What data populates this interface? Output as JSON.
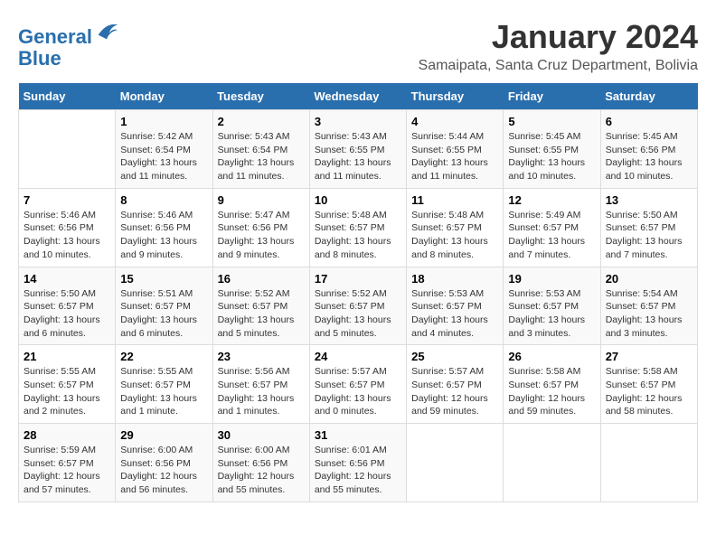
{
  "logo": {
    "line1": "General",
    "line2": "Blue"
  },
  "title": "January 2024",
  "subtitle": "Samaipata, Santa Cruz Department, Bolivia",
  "days_of_week": [
    "Sunday",
    "Monday",
    "Tuesday",
    "Wednesday",
    "Thursday",
    "Friday",
    "Saturday"
  ],
  "weeks": [
    [
      {
        "day": "",
        "sunrise": "",
        "sunset": "",
        "daylight": ""
      },
      {
        "day": "1",
        "sunrise": "Sunrise: 5:42 AM",
        "sunset": "Sunset: 6:54 PM",
        "daylight": "Daylight: 13 hours and 11 minutes."
      },
      {
        "day": "2",
        "sunrise": "Sunrise: 5:43 AM",
        "sunset": "Sunset: 6:54 PM",
        "daylight": "Daylight: 13 hours and 11 minutes."
      },
      {
        "day": "3",
        "sunrise": "Sunrise: 5:43 AM",
        "sunset": "Sunset: 6:55 PM",
        "daylight": "Daylight: 13 hours and 11 minutes."
      },
      {
        "day": "4",
        "sunrise": "Sunrise: 5:44 AM",
        "sunset": "Sunset: 6:55 PM",
        "daylight": "Daylight: 13 hours and 11 minutes."
      },
      {
        "day": "5",
        "sunrise": "Sunrise: 5:45 AM",
        "sunset": "Sunset: 6:55 PM",
        "daylight": "Daylight: 13 hours and 10 minutes."
      },
      {
        "day": "6",
        "sunrise": "Sunrise: 5:45 AM",
        "sunset": "Sunset: 6:56 PM",
        "daylight": "Daylight: 13 hours and 10 minutes."
      }
    ],
    [
      {
        "day": "7",
        "sunrise": "Sunrise: 5:46 AM",
        "sunset": "Sunset: 6:56 PM",
        "daylight": "Daylight: 13 hours and 10 minutes."
      },
      {
        "day": "8",
        "sunrise": "Sunrise: 5:46 AM",
        "sunset": "Sunset: 6:56 PM",
        "daylight": "Daylight: 13 hours and 9 minutes."
      },
      {
        "day": "9",
        "sunrise": "Sunrise: 5:47 AM",
        "sunset": "Sunset: 6:56 PM",
        "daylight": "Daylight: 13 hours and 9 minutes."
      },
      {
        "day": "10",
        "sunrise": "Sunrise: 5:48 AM",
        "sunset": "Sunset: 6:57 PM",
        "daylight": "Daylight: 13 hours and 8 minutes."
      },
      {
        "day": "11",
        "sunrise": "Sunrise: 5:48 AM",
        "sunset": "Sunset: 6:57 PM",
        "daylight": "Daylight: 13 hours and 8 minutes."
      },
      {
        "day": "12",
        "sunrise": "Sunrise: 5:49 AM",
        "sunset": "Sunset: 6:57 PM",
        "daylight": "Daylight: 13 hours and 7 minutes."
      },
      {
        "day": "13",
        "sunrise": "Sunrise: 5:50 AM",
        "sunset": "Sunset: 6:57 PM",
        "daylight": "Daylight: 13 hours and 7 minutes."
      }
    ],
    [
      {
        "day": "14",
        "sunrise": "Sunrise: 5:50 AM",
        "sunset": "Sunset: 6:57 PM",
        "daylight": "Daylight: 13 hours and 6 minutes."
      },
      {
        "day": "15",
        "sunrise": "Sunrise: 5:51 AM",
        "sunset": "Sunset: 6:57 PM",
        "daylight": "Daylight: 13 hours and 6 minutes."
      },
      {
        "day": "16",
        "sunrise": "Sunrise: 5:52 AM",
        "sunset": "Sunset: 6:57 PM",
        "daylight": "Daylight: 13 hours and 5 minutes."
      },
      {
        "day": "17",
        "sunrise": "Sunrise: 5:52 AM",
        "sunset": "Sunset: 6:57 PM",
        "daylight": "Daylight: 13 hours and 5 minutes."
      },
      {
        "day": "18",
        "sunrise": "Sunrise: 5:53 AM",
        "sunset": "Sunset: 6:57 PM",
        "daylight": "Daylight: 13 hours and 4 minutes."
      },
      {
        "day": "19",
        "sunrise": "Sunrise: 5:53 AM",
        "sunset": "Sunset: 6:57 PM",
        "daylight": "Daylight: 13 hours and 3 minutes."
      },
      {
        "day": "20",
        "sunrise": "Sunrise: 5:54 AM",
        "sunset": "Sunset: 6:57 PM",
        "daylight": "Daylight: 13 hours and 3 minutes."
      }
    ],
    [
      {
        "day": "21",
        "sunrise": "Sunrise: 5:55 AM",
        "sunset": "Sunset: 6:57 PM",
        "daylight": "Daylight: 13 hours and 2 minutes."
      },
      {
        "day": "22",
        "sunrise": "Sunrise: 5:55 AM",
        "sunset": "Sunset: 6:57 PM",
        "daylight": "Daylight: 13 hours and 1 minute."
      },
      {
        "day": "23",
        "sunrise": "Sunrise: 5:56 AM",
        "sunset": "Sunset: 6:57 PM",
        "daylight": "Daylight: 13 hours and 1 minutes."
      },
      {
        "day": "24",
        "sunrise": "Sunrise: 5:57 AM",
        "sunset": "Sunset: 6:57 PM",
        "daylight": "Daylight: 13 hours and 0 minutes."
      },
      {
        "day": "25",
        "sunrise": "Sunrise: 5:57 AM",
        "sunset": "Sunset: 6:57 PM",
        "daylight": "Daylight: 12 hours and 59 minutes."
      },
      {
        "day": "26",
        "sunrise": "Sunrise: 5:58 AM",
        "sunset": "Sunset: 6:57 PM",
        "daylight": "Daylight: 12 hours and 59 minutes."
      },
      {
        "day": "27",
        "sunrise": "Sunrise: 5:58 AM",
        "sunset": "Sunset: 6:57 PM",
        "daylight": "Daylight: 12 hours and 58 minutes."
      }
    ],
    [
      {
        "day": "28",
        "sunrise": "Sunrise: 5:59 AM",
        "sunset": "Sunset: 6:57 PM",
        "daylight": "Daylight: 12 hours and 57 minutes."
      },
      {
        "day": "29",
        "sunrise": "Sunrise: 6:00 AM",
        "sunset": "Sunset: 6:56 PM",
        "daylight": "Daylight: 12 hours and 56 minutes."
      },
      {
        "day": "30",
        "sunrise": "Sunrise: 6:00 AM",
        "sunset": "Sunset: 6:56 PM",
        "daylight": "Daylight: 12 hours and 55 minutes."
      },
      {
        "day": "31",
        "sunrise": "Sunrise: 6:01 AM",
        "sunset": "Sunset: 6:56 PM",
        "daylight": "Daylight: 12 hours and 55 minutes."
      },
      {
        "day": "",
        "sunrise": "",
        "sunset": "",
        "daylight": ""
      },
      {
        "day": "",
        "sunrise": "",
        "sunset": "",
        "daylight": ""
      },
      {
        "day": "",
        "sunrise": "",
        "sunset": "",
        "daylight": ""
      }
    ]
  ]
}
